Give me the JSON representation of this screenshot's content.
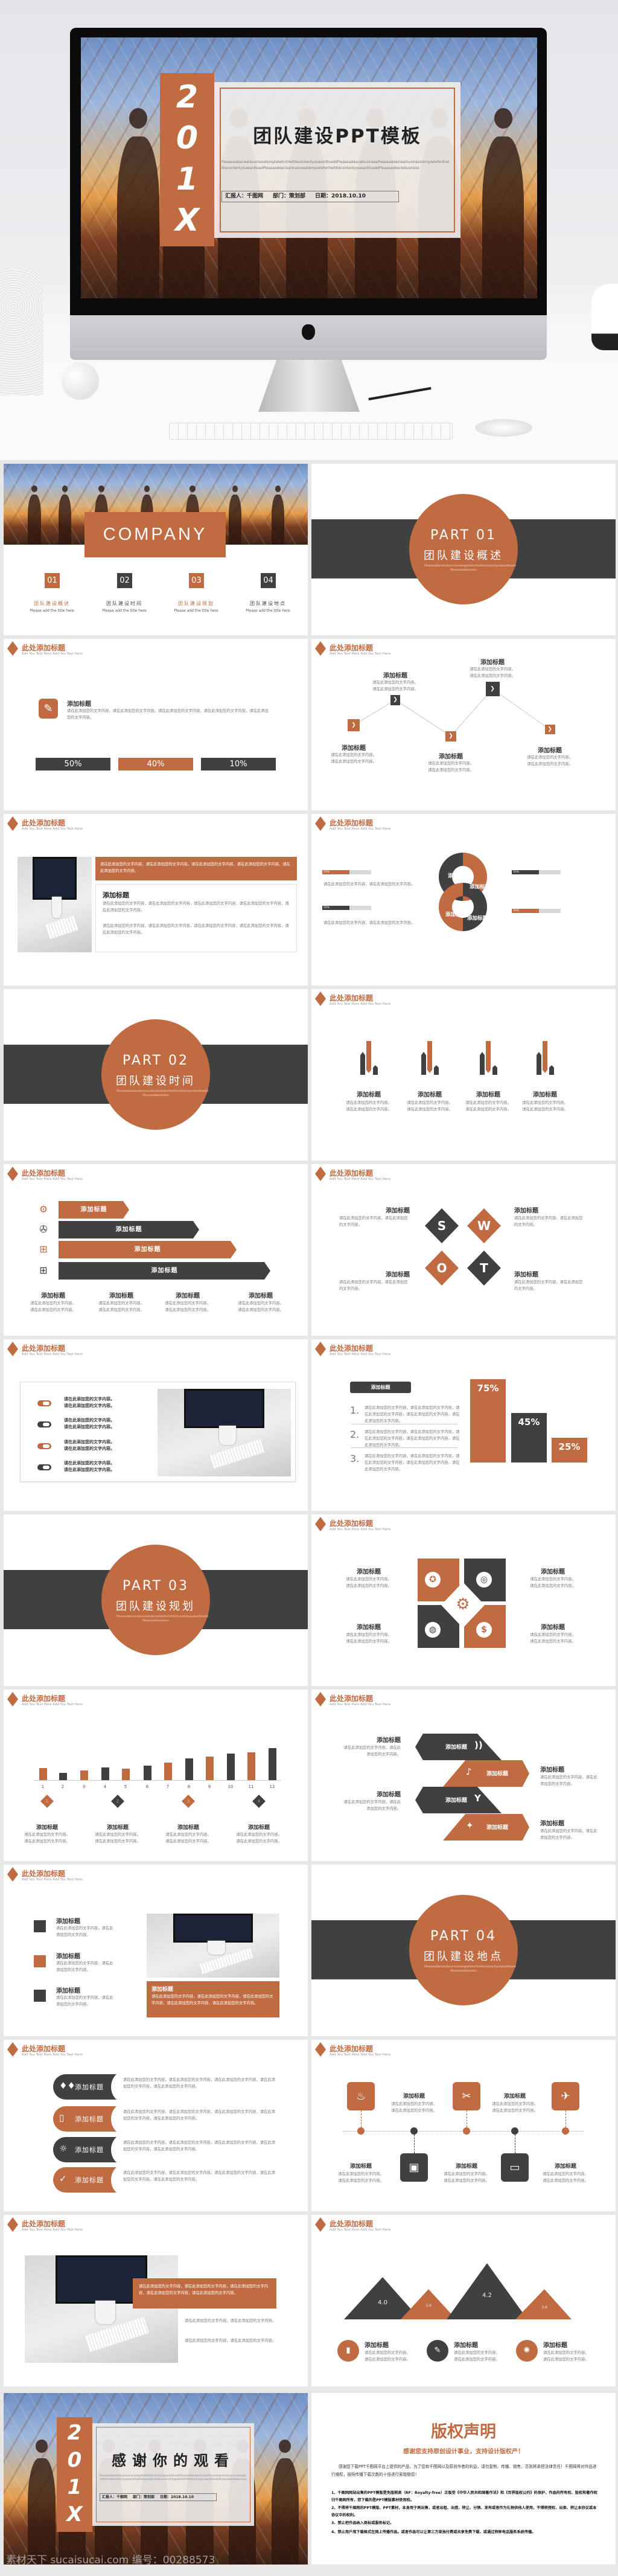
{
  "colors": {
    "accent": "#c06b41",
    "dark": "#404040",
    "background": "#e7e7e7"
  },
  "hero": {
    "year_chars": [
      "2",
      "0",
      "1",
      "X"
    ],
    "title": "团队建设PPT模板",
    "desc": "PleaseaddaclearbusinesstemplateforthetitlecontentyouwanttoaddPleaseaddaclebusinessPleaseaddaclearbusinesstemplateforthetitlecontentyouwanttoadPleaseaddaclearbusinesstemplateforthetitlecontentyouwanttoaddPleaseaddaclebusiness",
    "reporter": "汇报人：千图网",
    "dept": "部门：策划部",
    "date": "日期：2018.10.10",
    "logo_icon": "apple-logo-icon"
  },
  "common": {
    "header_title": "此处添加标题",
    "header_sub": "Add You Text Here Add You Text Here",
    "add_title": "添加标题",
    "s": "请在此添加您的文字内容。",
    "s2": "请在此添加您的文字内容，请在此添加您的文字内容。",
    "p": "请在此添加您的文字内容，请在此添加您的文字内容，请在此添加您的文字内容，请在此添加您的文字内容，请在此添加您的文字内容。",
    "part_desc": "Pleaseaddaclearbusinesstemplateforthetitlecontentyouwanttoadd Pleaseaddaclearbu",
    "chevron": "❯"
  },
  "slides": [
    {
      "type": "company",
      "title": "COMPANY",
      "items": [
        {
          "num": "01",
          "title": "团队建设概述",
          "sub": "Please add the title here"
        },
        {
          "num": "02",
          "title": "团队建设时间",
          "sub": "Please add the title here"
        },
        {
          "num": "03",
          "title": "团队建设规划",
          "sub": "Please add the title here"
        },
        {
          "num": "04",
          "title": "团队建设地点",
          "sub": "Please add the title here"
        }
      ]
    },
    {
      "type": "part",
      "part": "PART 01",
      "title": "团队建设概述"
    },
    {
      "type": "icon_percent",
      "icon": "pen-icon",
      "percents": [
        "50%",
        "40%",
        "10%"
      ]
    },
    {
      "type": "zigzag"
    },
    {
      "type": "photo_text"
    },
    {
      "type": "knot",
      "bars": [
        "50%",
        "50%",
        "50%",
        "50%"
      ],
      "bar_fill": 0.55
    },
    {
      "type": "part",
      "part": "PART 02",
      "title": "团队建设时间"
    },
    {
      "type": "pencils"
    },
    {
      "type": "arrows",
      "icons": [
        "gear-icon",
        "aperture-icon",
        "windows-icon",
        "windows-icon"
      ]
    },
    {
      "type": "swot",
      "letters": [
        "S",
        "W",
        "O",
        "T"
      ]
    },
    {
      "type": "toggles"
    },
    {
      "type": "bars",
      "values": [
        "75%",
        "45%",
        "25%"
      ],
      "numbers": [
        "1.",
        "2.",
        "3."
      ]
    },
    {
      "type": "part",
      "part": "PART 03",
      "title": "团队建设规划"
    },
    {
      "type": "quad",
      "icons": [
        "compass-icon",
        "target-icon",
        "globe-icon",
        "dollar-icon",
        "gear-icon"
      ]
    },
    {
      "type": "chart",
      "chart_data": {
        "type": "bar",
        "categories": [
          "1",
          "2",
          "3",
          "4",
          "5",
          "6",
          "7",
          "8",
          "9",
          "10",
          "11",
          "12"
        ],
        "values": [
          6.1,
          3.6,
          4.9,
          6.4,
          5.7,
          7.1,
          8.7,
          11,
          11.7,
          13.2,
          13.8,
          16
        ],
        "colors": [
          "#c06b41",
          "#404040"
        ]
      },
      "markers": [
        "1",
        "2",
        "3",
        "4"
      ]
    },
    {
      "type": "hex",
      "icons": [
        "volume-icon",
        "bell-icon",
        "cocktail-icon",
        "crystal-icon"
      ]
    },
    {
      "type": "squares"
    },
    {
      "type": "part",
      "part": "PART 04",
      "title": "团队建设地点"
    },
    {
      "type": "tabs",
      "icons": [
        "drops-icon",
        "cards-icon",
        "sun-icon",
        "check-icon"
      ]
    },
    {
      "type": "timeline",
      "icons": [
        "campfire-icon",
        "safe-icon",
        "tools-icon",
        "van-icon",
        "rocket-icon"
      ]
    },
    {
      "type": "photo_overlay"
    },
    {
      "type": "mountains",
      "values": [
        "4.0",
        "3.6",
        "4.2",
        "3.6"
      ],
      "icons": [
        "book-icon",
        "graduation-icon",
        "badge-icon"
      ]
    },
    {
      "type": "thanks",
      "title": "感谢你的观看",
      "watermark": "素材天下 sucaisucai.com  编号：00288573"
    },
    {
      "type": "copyright",
      "title": "版权声明",
      "subtitle": "感谢您支持原创设计事业，支持设计版权产！",
      "intro": "感谢您下载PPT千图网平台上提供的产品，为了您和千图网以及原创作者的利益，请勿复制、传播、销售，否则将承担法律责任！千图网将对作品进行维权，按照传播下载次数的十倍进行索取赔偿！",
      "items": [
        "1、千图网网站出售的PPT模版是免版税类（RF：Royalty-free）正版受《中华人民共和国著作法》和《世界版权公约》的保护，作品的所有权、版权和著作权归千图网所有，您下载的是PPT模版素材使用权。",
        "2、不得将千图网的PPT模版、PPT素材，本身用于再出售，或者出租、出借、转让、分销、发布或者作为礼物供他人使用，不得转授权、出卖、转让本协议或本协议中的权利。",
        "3、禁止把作品纳入商标或服务标记。",
        "4、禁止用户用下载格式在网上传播作品。或者作品可以让第三方单独付费或共享免费下载、或通过转移电话服务系统传播。"
      ]
    }
  ]
}
